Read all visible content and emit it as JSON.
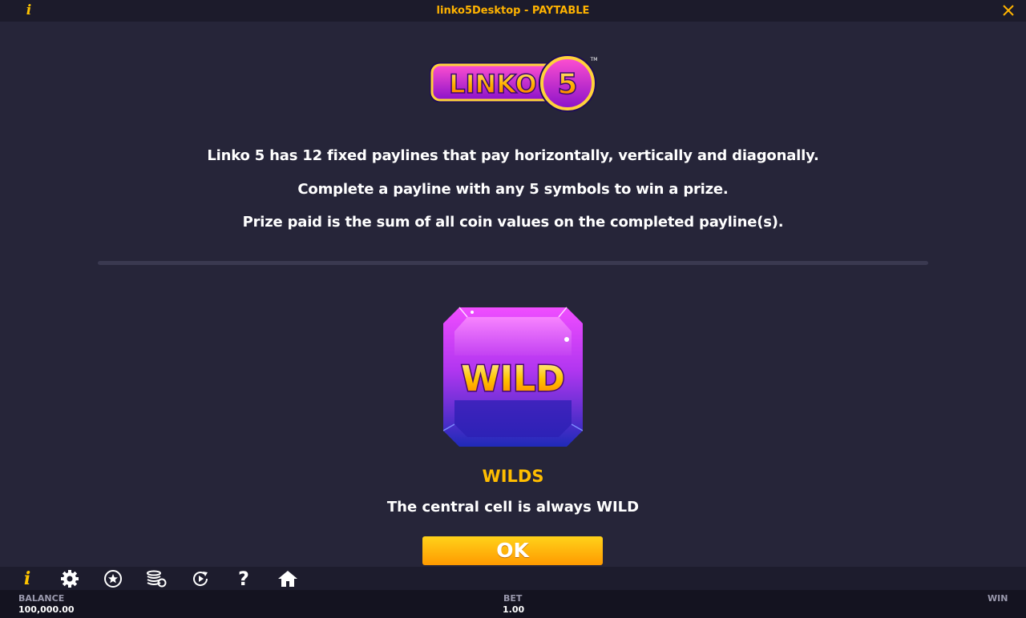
{
  "window": {
    "title": "linko5Desktop - PAYTABLE",
    "info_icon": "info-icon",
    "close_icon": "close-icon"
  },
  "logo": {
    "text": "LINKO",
    "number": "5",
    "trademark": "TM"
  },
  "rules": [
    "Linko 5 has 12 fixed paylines that pay horizontally, vertically and diagonally.",
    "Complete a payline with any 5 symbols to win a prize.",
    "Prize paid is the sum of all coin values on the completed payline(s)."
  ],
  "wild": {
    "symbol_text": "WILD",
    "title": "WILDS",
    "description": "The central cell is always WILD"
  },
  "ok_label": "OK",
  "toolbar": {
    "icons": [
      "info-icon",
      "settings-icon",
      "favorites-icon",
      "coins-icon",
      "autoplay-icon",
      "help-icon",
      "home-icon"
    ]
  },
  "status": {
    "balance_label": "BALANCE",
    "balance_value": "100,000.00",
    "bet_label": "BET",
    "bet_value": "1.00",
    "win_label": "WIN"
  },
  "colors": {
    "background": "#262539",
    "accent": "#ffbd00",
    "button": "#ffa800"
  }
}
